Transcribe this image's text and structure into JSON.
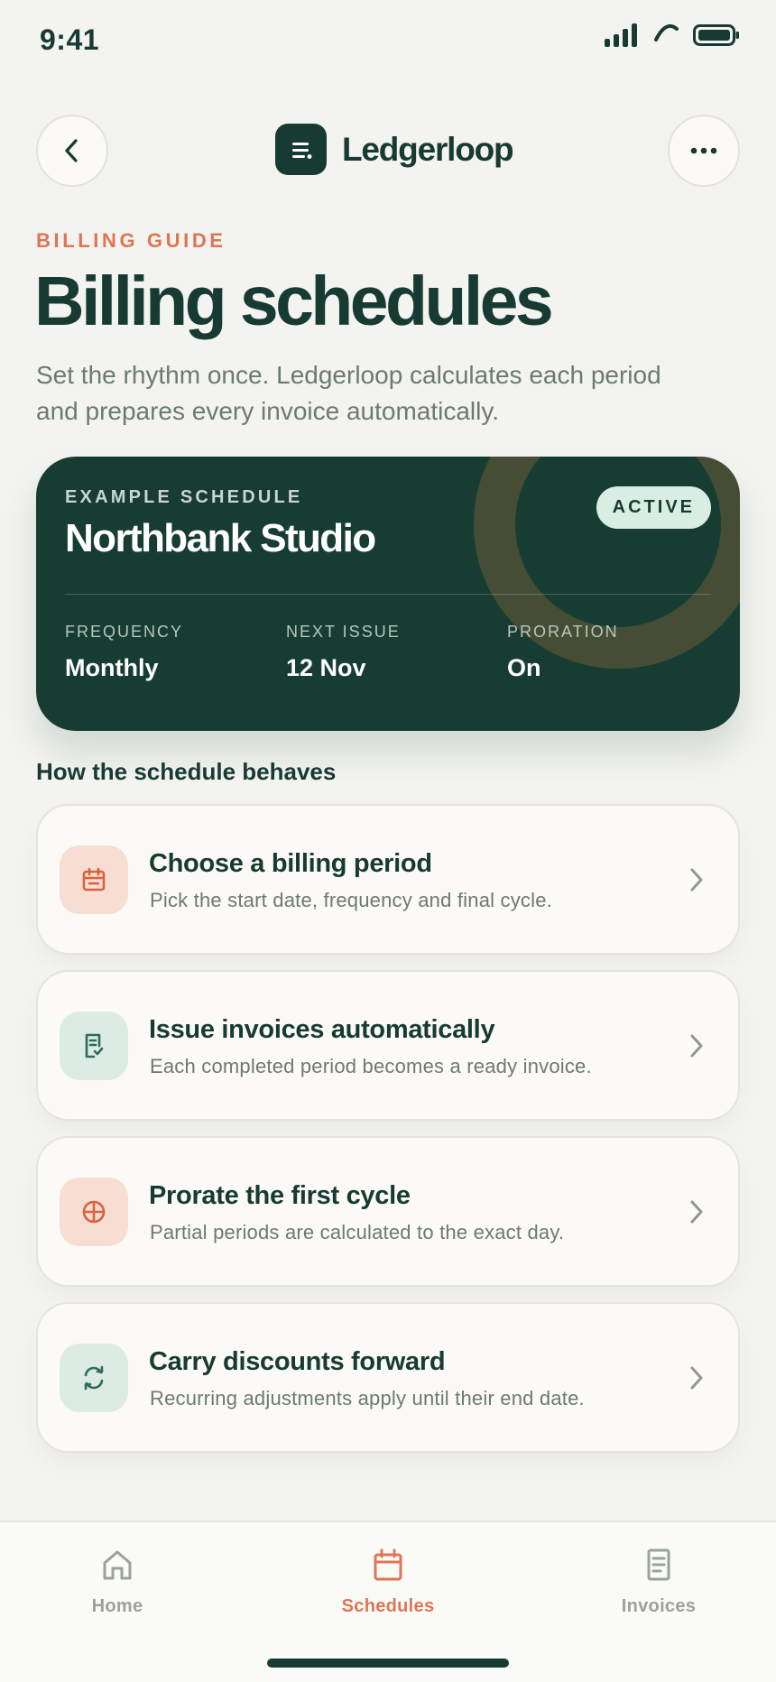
{
  "status": {
    "time": "9:41"
  },
  "header": {
    "brand": "Ledgerloop",
    "back_icon": "chevron-left-icon",
    "more_icon": "ellipsis-icon"
  },
  "page": {
    "eyebrow": "BILLING GUIDE",
    "title": "Billing schedules",
    "subtitle": "Set the rhythm once. Ledgerloop calculates each period and prepares every invoice automatically."
  },
  "hero": {
    "eyebrow": "EXAMPLE SCHEDULE",
    "title": "Northbank Studio",
    "badge": "ACTIVE",
    "stats": [
      {
        "label": "FREQUENCY",
        "value": "Monthly"
      },
      {
        "label": "NEXT ISSUE",
        "value": "12 Nov"
      },
      {
        "label": "PRORATION",
        "value": "On"
      }
    ]
  },
  "section": {
    "title": "How the schedule behaves"
  },
  "steps": [
    {
      "title": "Choose a billing period",
      "description": "Pick the start date, frequency and final cycle.",
      "icon": "calendar-icon"
    },
    {
      "title": "Issue invoices automatically",
      "description": "Each completed period becomes a ready invoice.",
      "icon": "invoice-icon"
    },
    {
      "title": "Prorate the first cycle",
      "description": "Partial periods are calculated to the exact day.",
      "icon": "crosshair-icon"
    },
    {
      "title": "Carry discounts forward",
      "description": "Recurring adjustments apply until their end date.",
      "icon": "repeat-icon"
    }
  ],
  "tabs": [
    {
      "label": "Home",
      "icon": "home-icon"
    },
    {
      "label": "Schedules",
      "icon": "calendar-icon",
      "active": true
    },
    {
      "label": "Invoices",
      "icon": "document-icon"
    }
  ],
  "colors": {
    "brand_dark": "#173b32",
    "accent": "#e07554",
    "hero_bg": "#173d33",
    "badge_bg": "#d8eee3",
    "coral_tint": "#f8ddd2",
    "mint_tint": "#dcece4"
  }
}
